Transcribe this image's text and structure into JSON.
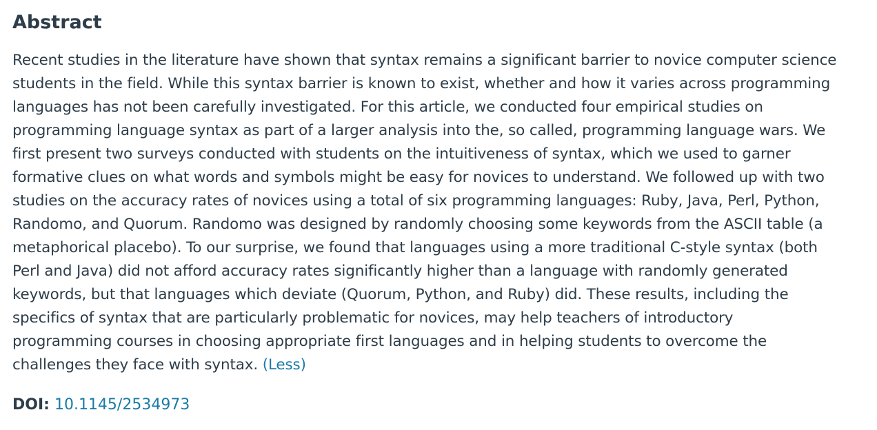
{
  "section": {
    "heading": "Abstract"
  },
  "abstract": {
    "lines": [
      "Recent studies in the literature have shown that syntax remains a significant barrier to novice computer science",
      "students in the field. While this syntax barrier is known to exist, whether and how it varies across programming",
      "languages has not been carefully investigated. For this article, we conducted four empirical studies on",
      "programming language syntax as part of a larger analysis into the, so called, programming language wars. We",
      "first present two surveys conducted with students on the intuitiveness of syntax, which we used to garner",
      "formative clues on what words and symbols might be easy for novices to understand. We followed up with two",
      "studies on the accuracy rates of novices using a total of six programming languages: Ruby, Java, Perl, Python,",
      "Randomo, and Quorum. Randomo was designed by randomly choosing some keywords from the ASCII table (a",
      "metaphorical placebo). To our surprise, we found that languages using a more traditional C-style syntax (both",
      "Perl and Java) did not afford accuracy rates significantly higher than a language with randomly generated",
      "keywords, but that languages which deviate (Quorum, Python, and Ruby) did. These results, including the",
      "specifics of syntax that are particularly problematic for novices, may help teachers of introductory",
      "programming courses in choosing appropriate first languages and in helping students to overcome the",
      "challenges they face with syntax."
    ],
    "less_label": "(Less)"
  },
  "doi": {
    "label": "DOI:",
    "value": "10.1145/2534973"
  },
  "colors": {
    "text": "#2e3d49",
    "link": "#1a7aa8"
  }
}
